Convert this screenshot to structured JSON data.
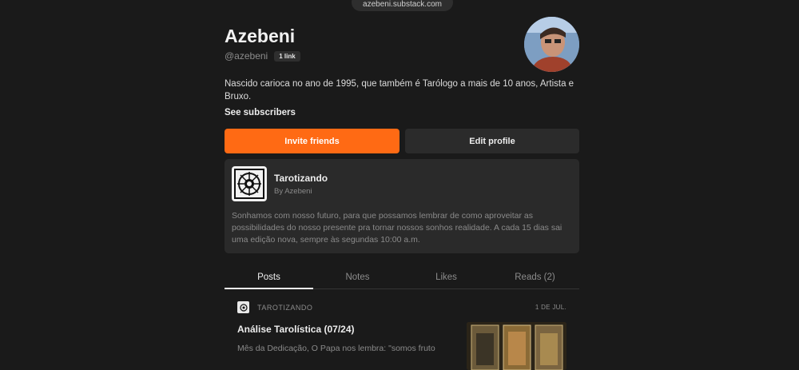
{
  "browser": {
    "url": "azebeni.substack.com"
  },
  "profile": {
    "name": "Azebeni",
    "handle": "@azebeni",
    "links_badge": "1 link",
    "bio": "Nascido carioca no ano de 1995, que também é Tarólogo a mais de 10 anos, Artista e Bruxo.",
    "see_subscribers": "See subscribers",
    "avatar_icon": "user-avatar-photo"
  },
  "actions": {
    "invite_label": "Invite friends",
    "edit_label": "Edit profile",
    "accent_color": "#ff6a14"
  },
  "publication": {
    "title": "Tarotizando",
    "by": "By Azebeni",
    "description": "Sonhamos com nosso futuro, para que possamos lembrar de como aproveitar as possibilidades do nosso presente pra tornar nossos sonhos realidade. A cada 15 dias sai uma edição nova, sempre às segundas 10:00 a.m.",
    "logo_icon": "tarot-sigil-icon"
  },
  "tabs": [
    {
      "label": "Posts",
      "active": true
    },
    {
      "label": "Notes",
      "active": false
    },
    {
      "label": "Likes",
      "active": false
    },
    {
      "label": "Reads (2)",
      "active": false
    }
  ],
  "post": {
    "publication": "TAROTIZANDO",
    "date": "1 DE JUL.",
    "title": "Análise Tarolística (07/24)",
    "excerpt": "Mês da Dedicação, O Papa nos lembra: \"somos fruto"
  }
}
